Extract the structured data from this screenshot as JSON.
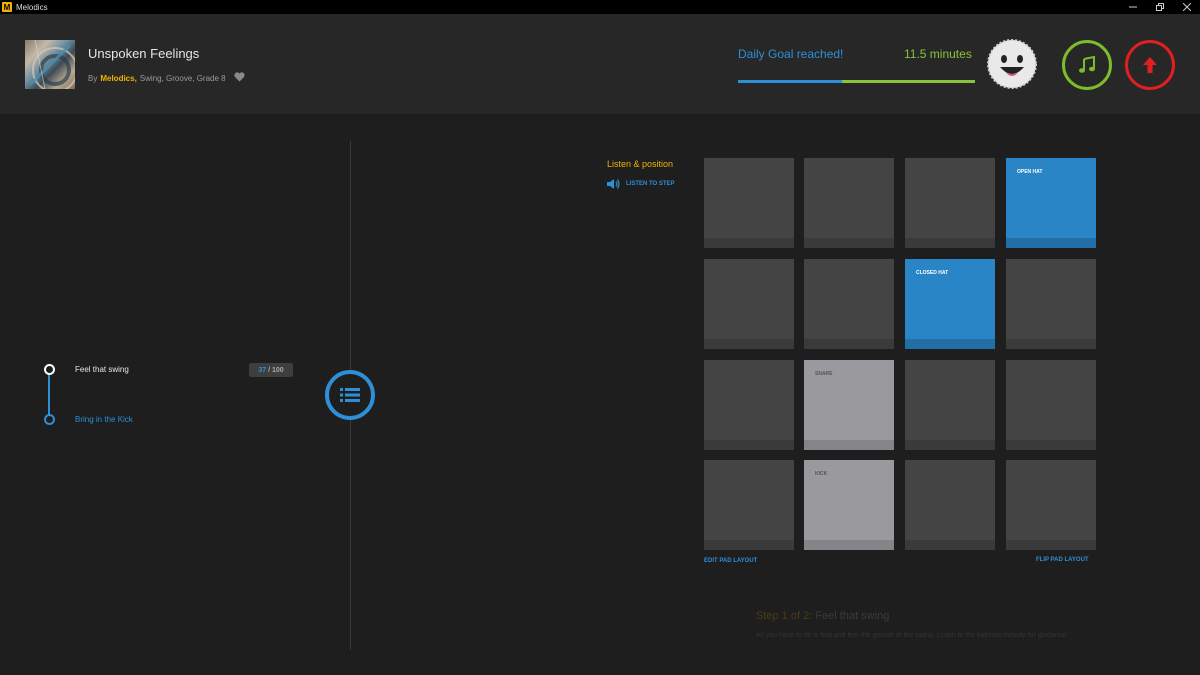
{
  "window": {
    "title": "Melodics",
    "icon_letter": "M"
  },
  "song": {
    "title": "Unspoken Feelings",
    "by_prefix": "By",
    "author": "Melodics,",
    "tags": "Swing, Groove, Grade 8"
  },
  "goal": {
    "text": "Daily Goal reached!",
    "minutes": "11.5 minutes",
    "progress": 1.0
  },
  "steps": {
    "items": [
      {
        "label": "Feel that swing"
      },
      {
        "label": "Bring in the Kick"
      }
    ],
    "progress_current": "37",
    "progress_sep": " / ",
    "progress_total": "100"
  },
  "pads": {
    "listen_title": "Listen & position",
    "listen_label": "LISTEN TO STEP",
    "labels": {
      "open_hat": "OPEN HAT",
      "closed_hat": "CLOSED HAT",
      "snare": "SNARE",
      "kick": "KICK"
    },
    "edit_label": "EDIT PAD LAYOUT",
    "flip_label": "FLIP PAD LAYOUT"
  },
  "step_info": {
    "number": "Step 1 of 2:",
    "title": "Feel that swing",
    "description": "All you have to do is find and feel the groove of the swing. Listen to the kalimba melody for guidance."
  },
  "colors": {
    "accent_blue": "#2e8fd6",
    "accent_yellow": "#f0b400",
    "accent_green": "#7cbd2c",
    "accent_red": "#e02020"
  }
}
